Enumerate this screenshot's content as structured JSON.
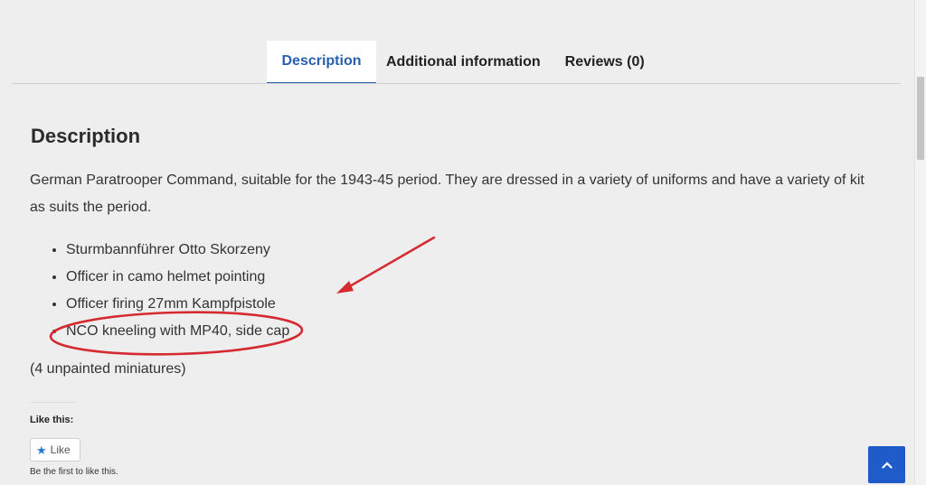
{
  "tabs": [
    {
      "label": "Description",
      "active": true
    },
    {
      "label": "Additional information",
      "active": false
    },
    {
      "label": "Reviews (0)",
      "active": false
    }
  ],
  "content": {
    "heading": "Description",
    "intro": "German Paratrooper Command, suitable for the 1943-45 period. They are dressed in a variety of uniforms and have a variety of kit as suits the period.",
    "items": [
      "Sturmbannführer Otto Skorzeny",
      "Officer in camo helmet pointing",
      "Officer firing 27mm Kampfpistole",
      "NCO kneeling with MP40, side cap"
    ],
    "note": "(4 unpainted miniatures)"
  },
  "like": {
    "title": "Like this:",
    "button_label": "Like",
    "icon": "star-icon",
    "first_text": "Be the first to like this."
  },
  "back_to_top": {
    "icon": "chevron-up-icon"
  },
  "colors": {
    "accent": "#2a5fb0",
    "annotation": "#d42a30",
    "button": "#1f5cc9"
  }
}
